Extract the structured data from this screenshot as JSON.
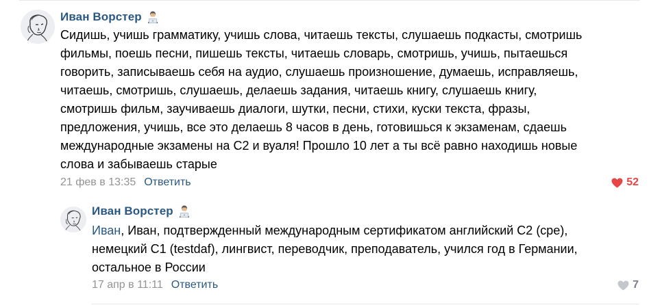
{
  "comments": [
    {
      "author": "Иван Ворстер",
      "author_emoji": "person-at-laptop-emoji",
      "text": "Сидишь, учишь грамматику, учишь слова, читаешь тексты, слушаешь подкасты, смотришь\nфильмы, поешь песни, пишешь тексты, читаешь словарь, смотришь, учишь, пытаешься\nговорить, записываешь себя на аудио, слушаешь произношение, думаешь, исправляешь,\nчитаешь, смотришь, слушаешь, делаешь задания, читаешь книгу, слушаешь книгу,\nсмотришь фильм, заучиваешь диалоги, шутки, песни, стихи, куски текста, фразы,\nпредложения, учишь, все это делаешь 8 часов в день, готовишься к экзаменам, сдаешь\nмеждународные экзамены на С2 и вуаля! Прошло 10 лет а ты всё равно находишь новые\nслова и забываешь старые",
      "timestamp": "21 фев в 13:35",
      "reply_label": "Ответить",
      "likes": "52",
      "liked": true
    },
    {
      "author": "Иван Ворстер",
      "author_emoji": "person-at-laptop-emoji",
      "reply_to": "Иван",
      "text": ", Иван, подтвержденный международным сертификатом английский C2 (cpe),\nнемецкий C1 (testdaf), лингвист, переводчик, преподаватель, учился год в Германии,\nостальное в России",
      "timestamp": "17 апр в 11:11",
      "reply_label": "Ответить",
      "likes": "7",
      "liked": false
    }
  ],
  "colors": {
    "link": "#2a5885",
    "meta": "#939393",
    "like_active": "#e64646",
    "like_inactive": "#c4c8cc"
  }
}
